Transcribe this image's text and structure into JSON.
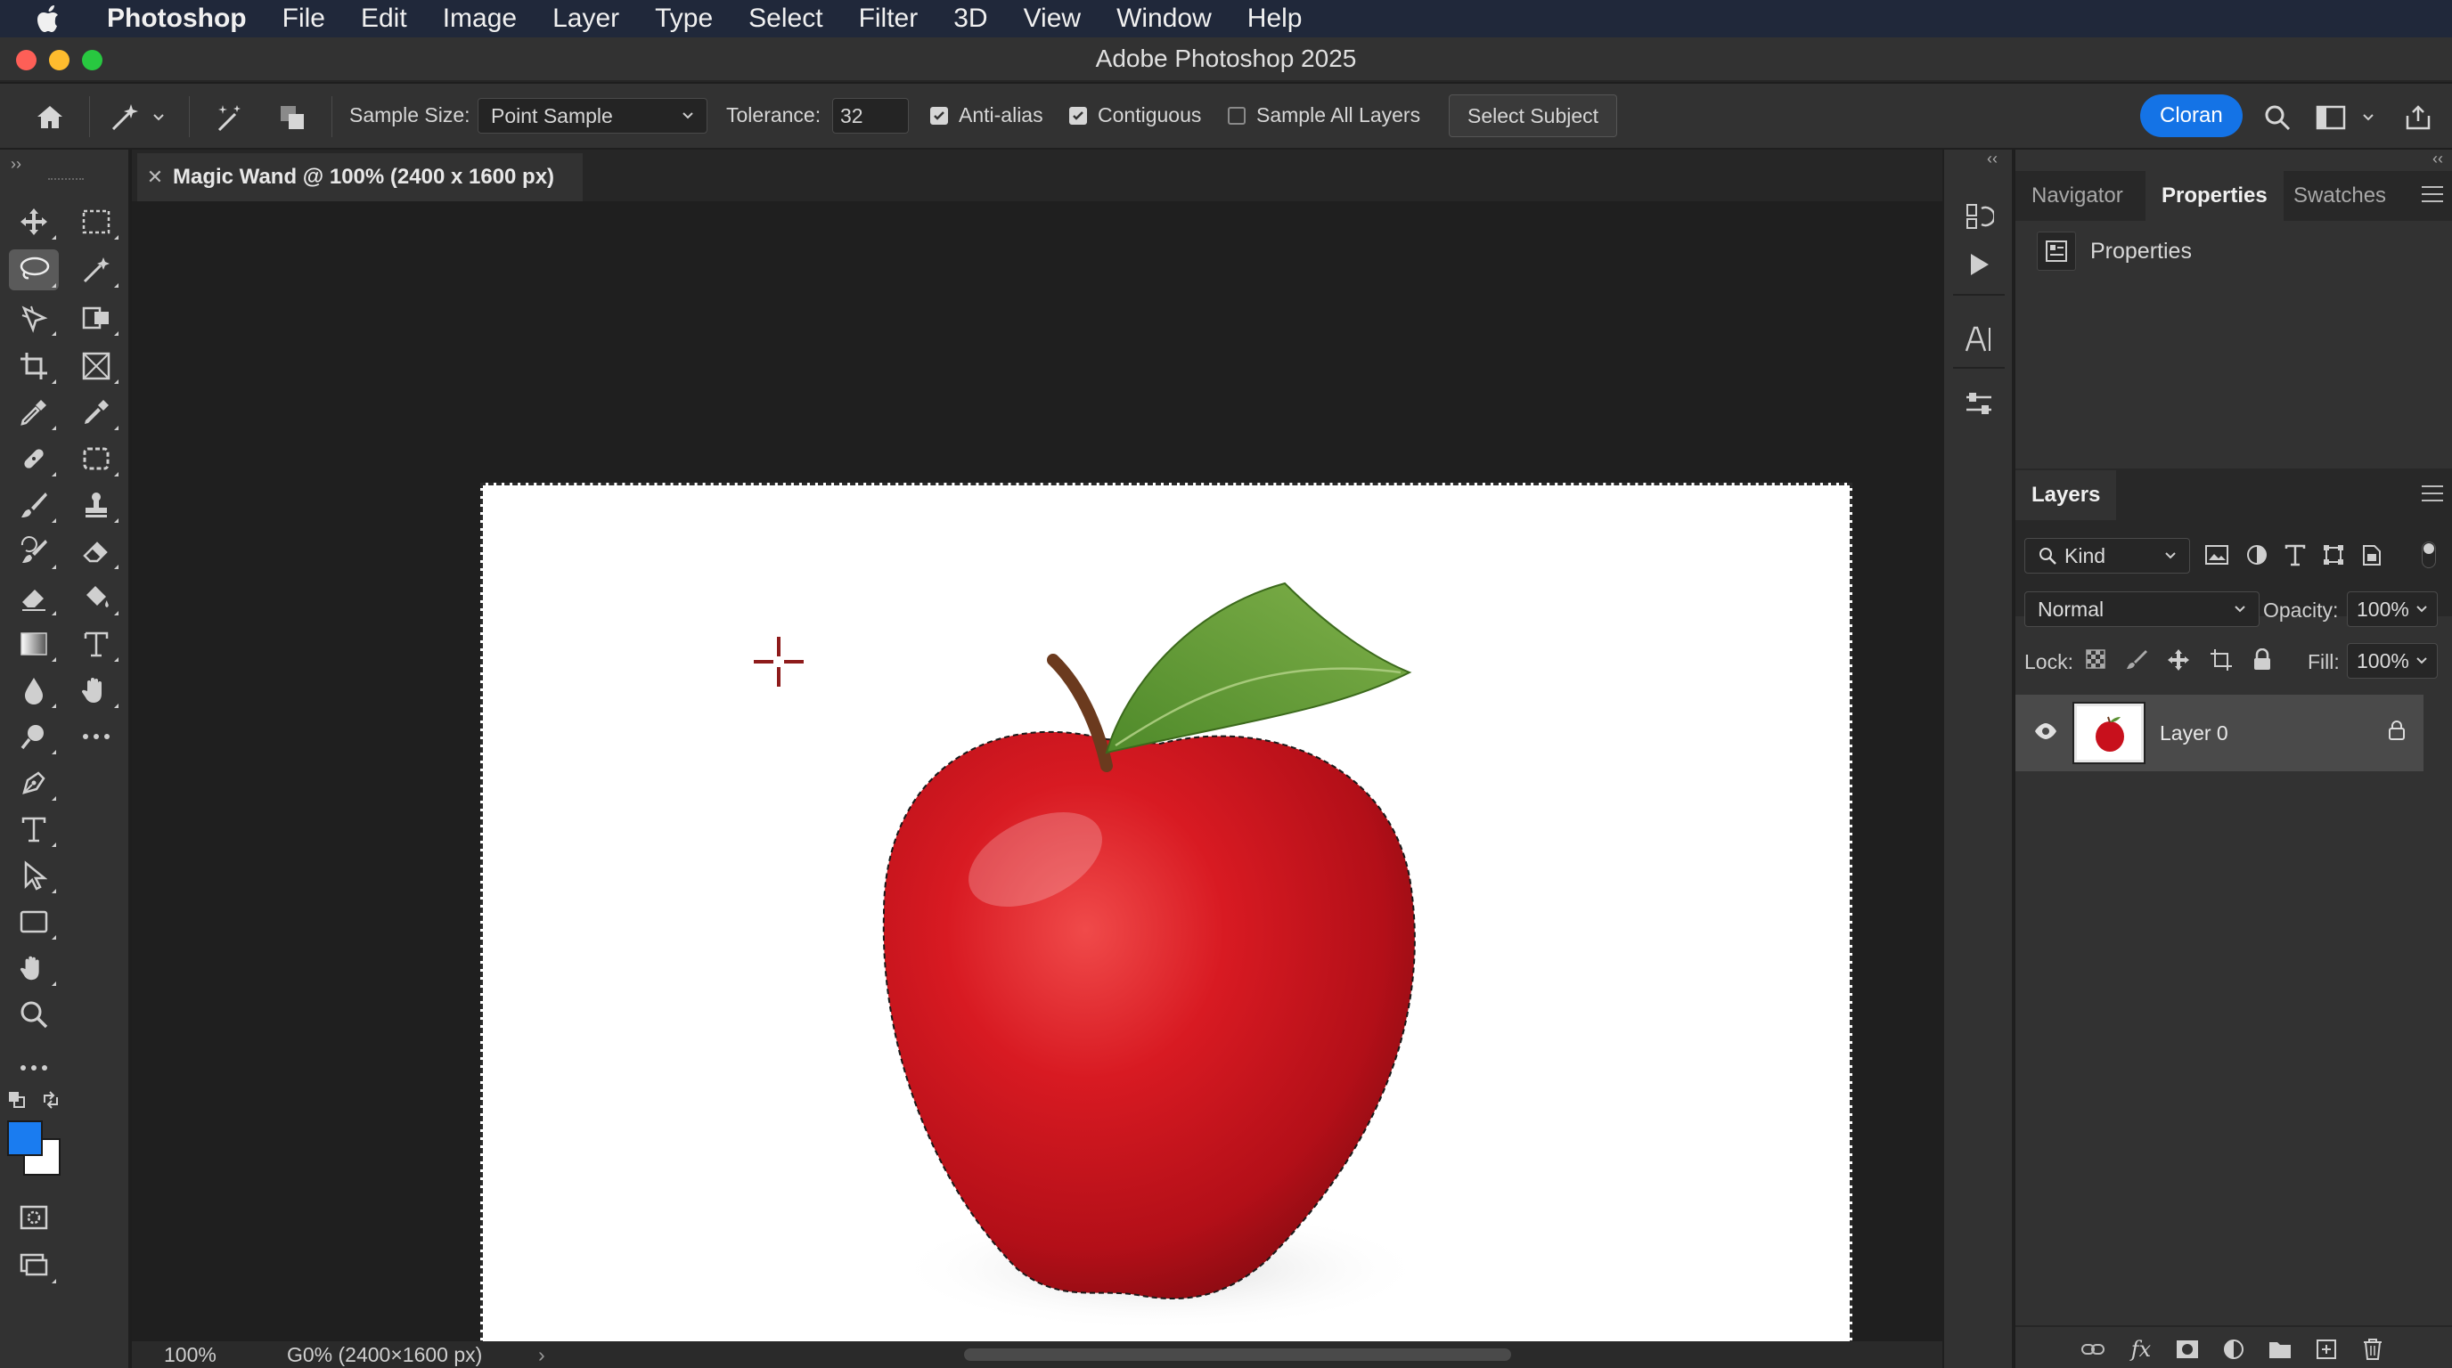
{
  "menubar": {
    "app_name": "Photoshop",
    "items": [
      "File",
      "Edit",
      "Image",
      "Layer",
      "Type",
      "Select",
      "Filter",
      "3D",
      "View",
      "Window",
      "Help"
    ]
  },
  "window": {
    "title": "Adobe Photoshop 2025"
  },
  "options": {
    "sample_size_label": "Sample Size:",
    "sample_size_value": "Point Sample",
    "tolerance_label": "Tolerance:",
    "tolerance_value": "32",
    "anti_alias_label": "Anti-alias",
    "anti_alias_checked": true,
    "contiguous_label": "Contiguous",
    "contiguous_checked": true,
    "sample_all_layers_label": "Sample All Layers",
    "sample_all_layers_checked": false,
    "select_subject_label": "Select Subject",
    "share_label": "Cloran"
  },
  "toolbar": {
    "active_tool": "lasso-tool",
    "foreground_color": "#1a7cf0",
    "background_color": "#ffffff"
  },
  "document": {
    "tab_title": "Magic Wand @ 100% (2400 x 1600 px)",
    "zoom": "100%",
    "status_info": "G0% (2400×1600 px)"
  },
  "panels": {
    "top_tabs": [
      "Navigator",
      "Properties",
      "Swatches"
    ],
    "top_active": "Properties",
    "properties_heading": "Properties",
    "layers_tab": "Layers",
    "filter_kind": "Kind",
    "blend_mode": "Normal",
    "opacity_label": "Opacity:",
    "opacity_value": "100%",
    "lock_label": "Lock:",
    "fill_label": "Fill:",
    "fill_value": "100%",
    "layers": [
      {
        "name": "Layer 0",
        "visible": true,
        "locked": true
      }
    ]
  },
  "colors": {
    "accent": "#1473e6",
    "apple_red": "#c8101c",
    "leaf_green": "#5a8f32"
  }
}
